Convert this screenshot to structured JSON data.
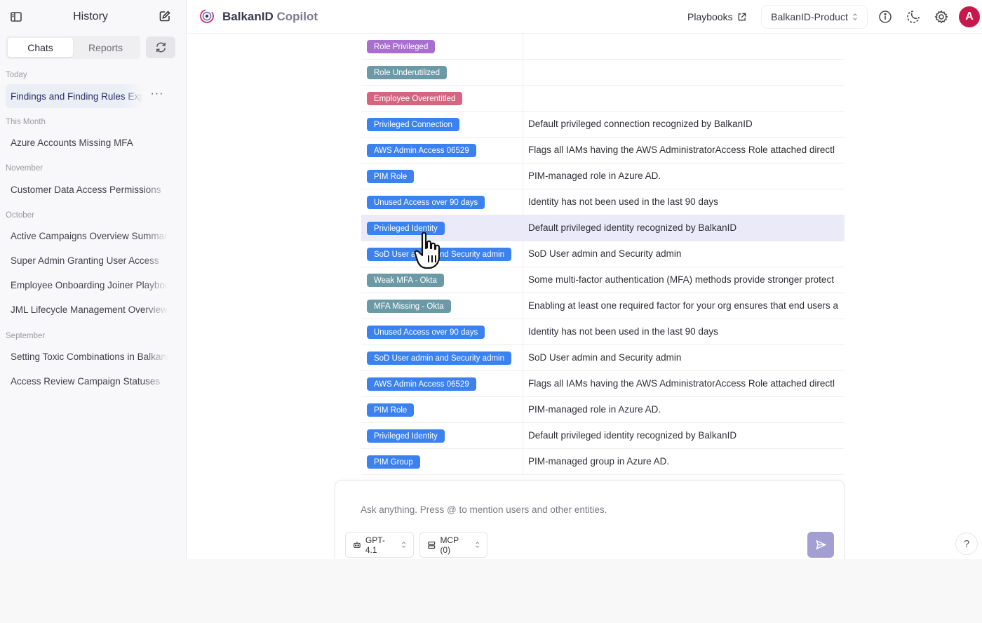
{
  "sidebar": {
    "title": "History",
    "tabs": [
      {
        "label": "Chats"
      },
      {
        "label": "Reports"
      }
    ],
    "groups": [
      {
        "label": "Today",
        "items": [
          {
            "label": "Findings and Finding Rules Explained"
          }
        ]
      },
      {
        "label": "This Month",
        "items": [
          {
            "label": "Azure Accounts Missing MFA"
          }
        ]
      },
      {
        "label": "November",
        "items": [
          {
            "label": "Customer Data Access Permissions"
          }
        ]
      },
      {
        "label": "October",
        "items": [
          {
            "label": "Active Campaigns Overview Summary"
          },
          {
            "label": "Super Admin Granting User Access"
          },
          {
            "label": "Employee Onboarding Joiner Playbook"
          },
          {
            "label": "JML Lifecycle Management Overview"
          }
        ]
      },
      {
        "label": "September",
        "items": [
          {
            "label": "Setting Toxic Combinations in BalkanID"
          },
          {
            "label": "Access Review Campaign Statuses"
          }
        ]
      }
    ],
    "more_glyph": "···"
  },
  "topbar": {
    "brand_strong": "BalkanID",
    "brand_soft": "Copilot",
    "playbooks_label": "Playbooks",
    "tenant_label": "BalkanID-Product",
    "avatar_initial": "A"
  },
  "table": {
    "rows": [
      {
        "tag": "Role Privileged",
        "color": "#a86fd0",
        "description": ""
      },
      {
        "tag": "Role Underutilized",
        "color": "#6b9aa6",
        "description": ""
      },
      {
        "tag": "Employee Overentitled",
        "color": "#d4667f",
        "description": ""
      },
      {
        "tag": "Privileged Connection",
        "color": "#3b82f0",
        "description": "Default privileged connection recognized by BalkanID"
      },
      {
        "tag": "AWS Admin Access 06529",
        "color": "#3b82f0",
        "description": "Flags all IAMs having the AWS AdministratorAccess Role attached directl"
      },
      {
        "tag": "PIM Role",
        "color": "#3b82f0",
        "description": "PIM-managed role in Azure AD."
      },
      {
        "tag": "Unused Access over 90 days",
        "color": "#3b82f0",
        "description": "Identity has not been used in the last 90 days"
      },
      {
        "tag": "Privileged Identity",
        "color": "#3b82f0",
        "description": "Default privileged identity recognized by BalkanID",
        "highlighted": true
      },
      {
        "tag": "SoD User admin and Security admin",
        "color": "#3b82f0",
        "description": "SoD User admin and Security admin"
      },
      {
        "tag": "Weak MFA - Okta",
        "color": "#6b9aa6",
        "description": "Some multi-factor authentication (MFA) methods provide stronger protect"
      },
      {
        "tag": "MFA Missing - Okta",
        "color": "#6b9aa6",
        "description": "Enabling at least one required factor for your org ensures that end users a"
      },
      {
        "tag": "Unused Access over 90 days",
        "color": "#3b82f0",
        "description": "Identity has not been used in the last 90 days"
      },
      {
        "tag": "SoD User admin and Security admin",
        "color": "#3b82f0",
        "description": "SoD User admin and Security admin"
      },
      {
        "tag": "AWS Admin Access 06529",
        "color": "#3b82f0",
        "description": "Flags all IAMs having the AWS AdministratorAccess Role attached directl"
      },
      {
        "tag": "PIM Role",
        "color": "#3b82f0",
        "description": "PIM-managed role in Azure AD."
      },
      {
        "tag": "Privileged Identity",
        "color": "#3b82f0",
        "description": "Default privileged identity recognized by BalkanID"
      },
      {
        "tag": "PIM Group",
        "color": "#3b82f0",
        "description": "PIM-managed group in Azure AD."
      }
    ]
  },
  "composer": {
    "placeholder": "Ask anything. Press @ to mention users and other entities.",
    "model_label": "GPT-4.1",
    "mcp_label": "MCP (0)"
  },
  "help_label": "?",
  "colors": {
    "accent": "#a39fd2",
    "avatar": "#c8174a",
    "badge_blue": "#3b82f0"
  }
}
